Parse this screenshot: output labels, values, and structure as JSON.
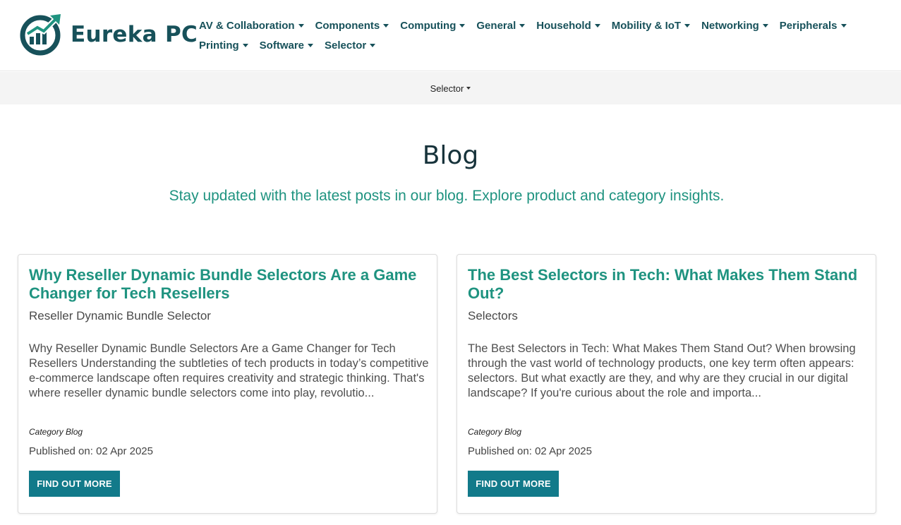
{
  "brand": {
    "name": "Eureka PC",
    "color": "#17515a",
    "accent": "#1f9380",
    "button": "#127a8a"
  },
  "nav": {
    "row1": [
      {
        "label": "AV & Collaboration",
        "name": "nav-item-av-collaboration"
      },
      {
        "label": "Components",
        "name": "nav-item-components"
      },
      {
        "label": "Computing",
        "name": "nav-item-computing"
      },
      {
        "label": "General",
        "name": "nav-item-general"
      },
      {
        "label": "Household",
        "name": "nav-item-household"
      },
      {
        "label": "Mobility & IoT",
        "name": "nav-item-mobility-iot"
      },
      {
        "label": "Networking",
        "name": "nav-item-networking"
      },
      {
        "label": "Peripherals",
        "name": "nav-item-peripherals"
      }
    ],
    "row2": [
      {
        "label": "Printing",
        "name": "nav-item-printing"
      },
      {
        "label": "Software",
        "name": "nav-item-software"
      },
      {
        "label": "Selector",
        "name": "nav-item-selector"
      }
    ]
  },
  "subnav": {
    "label": "Selector"
  },
  "page": {
    "title": "Blog",
    "subtitle": "Stay updated with the latest posts in our blog. Explore product and category insights."
  },
  "posts": [
    {
      "title": "Why Reseller Dynamic Bundle Selectors Are a Game Changer for Tech Resellers",
      "tag": "Reseller Dynamic Bundle Selector",
      "excerpt": "Why Reseller Dynamic Bundle Selectors Are a Game Changer for Tech Resellers Understanding the subtleties of tech products in today’s competitive e-commerce landscape often requires creativity and strategic thinking. That's where reseller dynamic bundle selectors come into play, revolutio...",
      "category": "Category Blog",
      "published": "Published on: 02 Apr 2025",
      "button": "FIND OUT MORE"
    },
    {
      "title": "The Best Selectors in Tech: What Makes Them Stand Out?",
      "tag": "Selectors",
      "excerpt": "The Best Selectors in Tech: What Makes Them Stand Out? When browsing through the vast world of technology products, one key term often appears: selectors. But what exactly are they, and why are they crucial in our digital landscape? If you're curious about the role and importa...",
      "category": "Category Blog",
      "published": "Published on: 02 Apr 2025",
      "button": "FIND OUT MORE"
    }
  ]
}
